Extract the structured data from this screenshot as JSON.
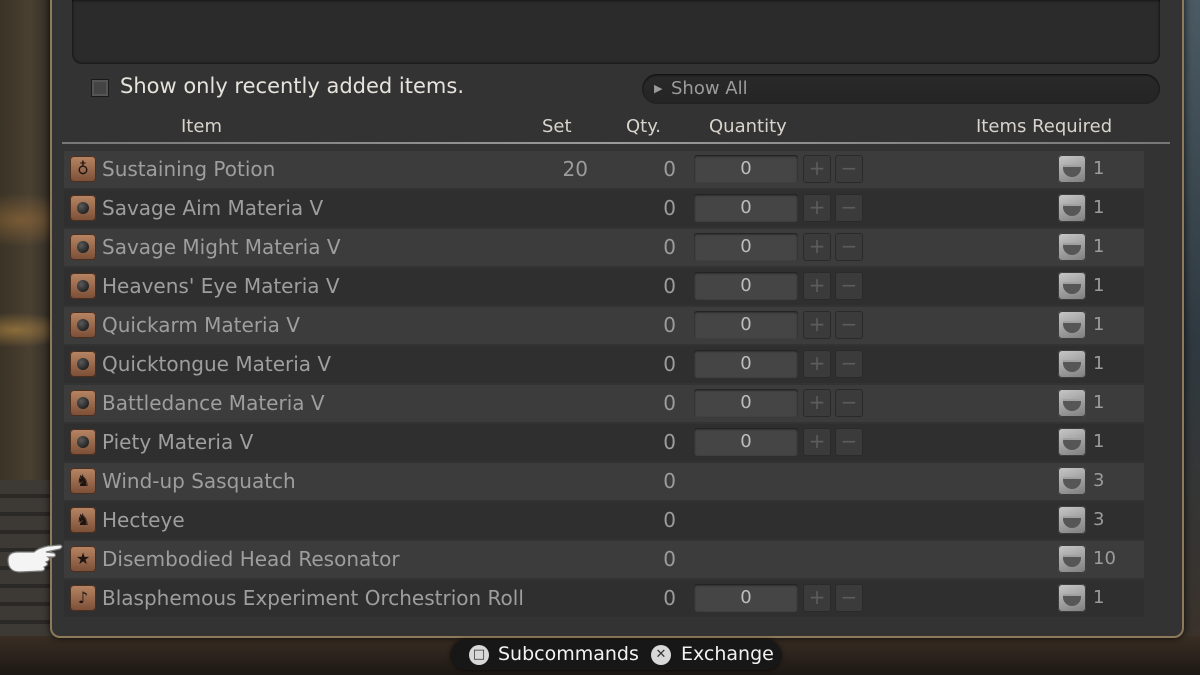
{
  "filter": {
    "label": "Show only recently added items.",
    "checked": false
  },
  "show_all": {
    "label": "Show All",
    "arrow": "right-triangle-icon"
  },
  "columns": {
    "item": "Item",
    "set": "Set",
    "qty": "Qty.",
    "quantity": "Quantity",
    "required": "Items Required"
  },
  "rows": [
    {
      "name": "Sustaining Potion",
      "icon": "potion-icon",
      "set": "20",
      "qty": "0",
      "quantity": "0",
      "required": "1",
      "has_stepper": true
    },
    {
      "name": "Savage Aim Materia V",
      "icon": "materia-icon",
      "set": "",
      "qty": "0",
      "quantity": "0",
      "required": "1",
      "has_stepper": true
    },
    {
      "name": "Savage Might Materia V",
      "icon": "materia-icon",
      "set": "",
      "qty": "0",
      "quantity": "0",
      "required": "1",
      "has_stepper": true
    },
    {
      "name": "Heavens' Eye Materia V",
      "icon": "materia-icon",
      "set": "",
      "qty": "0",
      "quantity": "0",
      "required": "1",
      "has_stepper": true
    },
    {
      "name": "Quickarm Materia V",
      "icon": "materia-icon",
      "set": "",
      "qty": "0",
      "quantity": "0",
      "required": "1",
      "has_stepper": true
    },
    {
      "name": "Quicktongue Materia V",
      "icon": "materia-icon",
      "set": "",
      "qty": "0",
      "quantity": "0",
      "required": "1",
      "has_stepper": true
    },
    {
      "name": "Battledance Materia V",
      "icon": "materia-icon",
      "set": "",
      "qty": "0",
      "quantity": "0",
      "required": "1",
      "has_stepper": true
    },
    {
      "name": "Piety Materia V",
      "icon": "materia-icon",
      "set": "",
      "qty": "0",
      "quantity": "0",
      "required": "1",
      "has_stepper": true
    },
    {
      "name": "Wind-up Sasquatch",
      "icon": "minion-icon",
      "set": "",
      "qty": "0",
      "quantity": "",
      "required": "3",
      "has_stepper": false
    },
    {
      "name": "Hecteye",
      "icon": "minion-icon",
      "set": "",
      "qty": "0",
      "quantity": "",
      "required": "3",
      "has_stepper": false
    },
    {
      "name": "Disembodied Head Resonator",
      "icon": "star-icon",
      "set": "",
      "qty": "0",
      "quantity": "",
      "required": "10",
      "has_stepper": false
    },
    {
      "name": "Blasphemous Experiment Orchestrion Roll",
      "icon": "music-note-icon",
      "set": "",
      "qty": "0",
      "quantity": "0",
      "required": "1",
      "has_stepper": true
    }
  ],
  "stepper": {
    "plus": "+",
    "minus": "−"
  },
  "footer": {
    "subcommands_label": "Subcommands",
    "exchange_label": "Exchange",
    "square_glyph": "□",
    "cross_glyph": "✕"
  }
}
